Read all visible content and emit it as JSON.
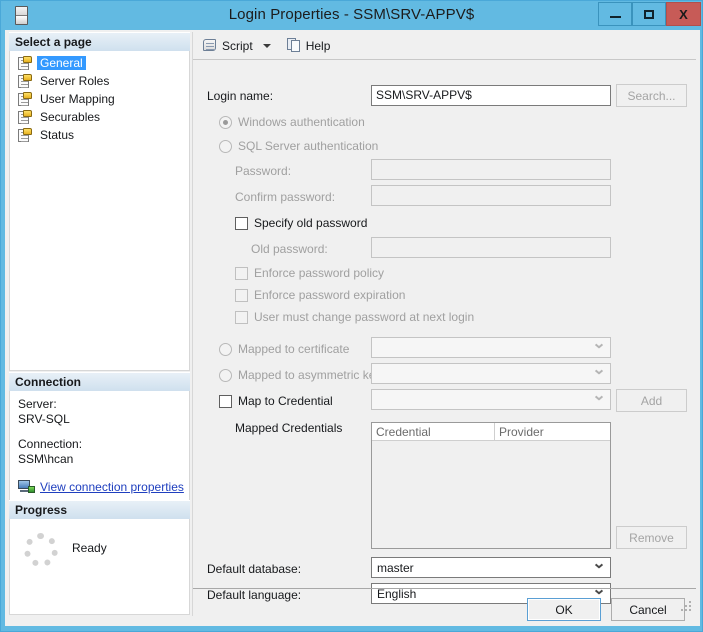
{
  "window": {
    "title": "Login Properties - SSM\\SRV-APPV$",
    "app_icon": "server-icon",
    "minimize_label": "",
    "maximize_label": "",
    "close_label": "X",
    "close_color": "#c75b57",
    "frame_color": "#62bae2"
  },
  "sidebar": {
    "select_page_header": "Select a page",
    "items": [
      {
        "label": "General",
        "selected": true
      },
      {
        "label": "Server Roles",
        "selected": false
      },
      {
        "label": "User Mapping",
        "selected": false
      },
      {
        "label": "Securables",
        "selected": false
      },
      {
        "label": "Status",
        "selected": false
      }
    ],
    "connection": {
      "header": "Connection",
      "server_label": "Server:",
      "server_value": "SRV-SQL",
      "connection_label": "Connection:",
      "connection_value": "SSM\\hcan",
      "view_properties_link": "View connection properties"
    },
    "progress": {
      "header": "Progress",
      "status": "Ready"
    }
  },
  "toolbar": {
    "script_label": "Script",
    "help_label": "Help"
  },
  "form": {
    "login_name_label": "Login name:",
    "login_name_value": "SSM\\SRV-APPV$",
    "search_button": "Search...",
    "windows_auth_label": "Windows authentication",
    "windows_auth_checked": true,
    "sql_auth_label": "SQL Server authentication",
    "sql_auth_checked": false,
    "password_label": "Password:",
    "password_value": "",
    "confirm_password_label": "Confirm password:",
    "confirm_password_value": "",
    "specify_old_password_label": "Specify old password",
    "specify_old_password_checked": false,
    "old_password_label": "Old password:",
    "old_password_value": "",
    "enforce_policy_label": "Enforce password policy",
    "enforce_policy_checked": false,
    "enforce_expiration_label": "Enforce password expiration",
    "enforce_expiration_checked": false,
    "must_change_label": "User must change password at next login",
    "must_change_checked": false,
    "mapped_certificate_label": "Mapped to certificate",
    "mapped_certificate_value": "",
    "mapped_asymmetric_label": "Mapped to asymmetric key",
    "mapped_asymmetric_value": "",
    "map_credential_label": "Map to Credential",
    "map_credential_checked": false,
    "map_credential_value": "",
    "add_button": "Add",
    "mapped_credentials_label": "Mapped Credentials",
    "credentials_grid": {
      "columns": [
        "Credential",
        "Provider"
      ],
      "rows": []
    },
    "remove_button": "Remove",
    "default_database_label": "Default database:",
    "default_database_value": "master",
    "default_language_label": "Default language:",
    "default_language_value": "English"
  },
  "footer": {
    "ok_button": "OK",
    "cancel_button": "Cancel"
  }
}
